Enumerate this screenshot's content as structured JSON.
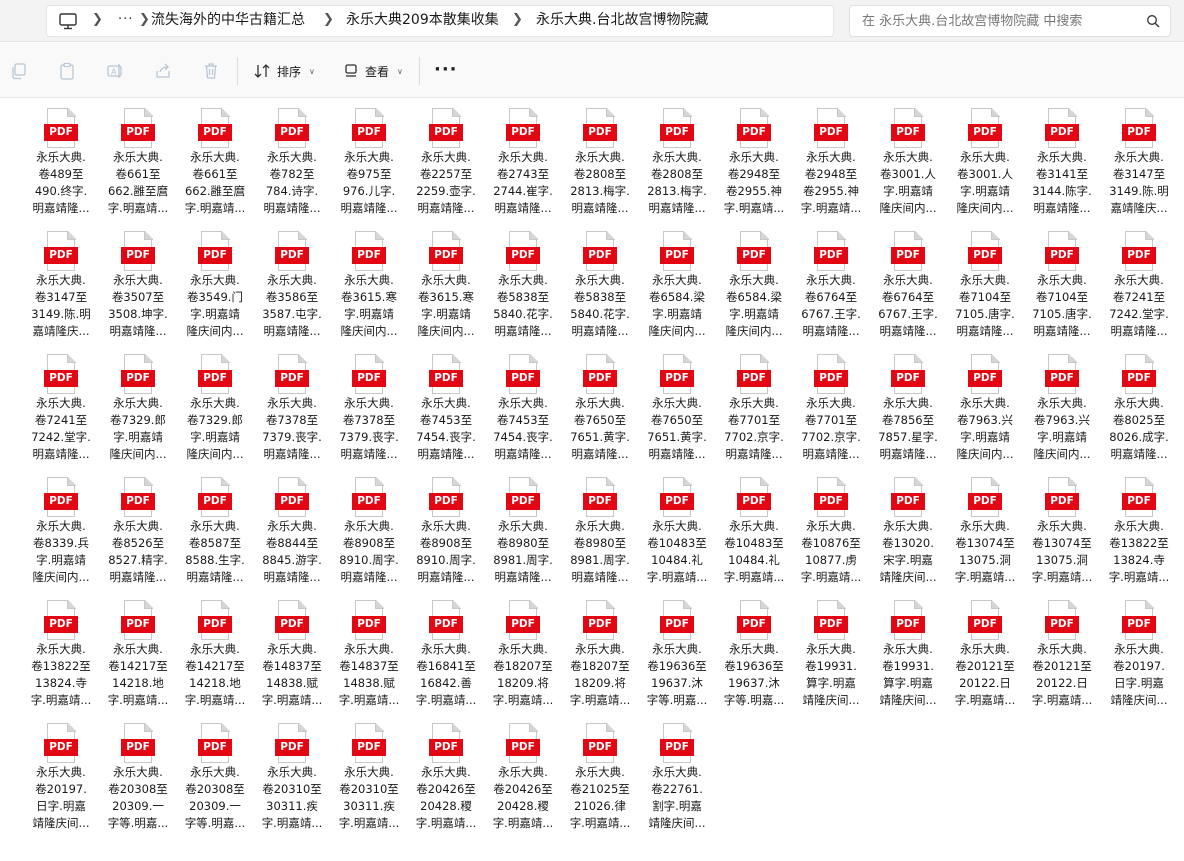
{
  "breadcrumb": {
    "more": "···",
    "items": [
      "流失海外的中华古籍汇总",
      "永乐大典209本散集收集",
      "永乐大典.台北故宫博物院藏"
    ]
  },
  "search": {
    "placeholder": "在 永乐大典.台北故宫博物院藏 中搜索"
  },
  "toolbar": {
    "sort_label": "排序",
    "view_label": "查看",
    "more_label": "···"
  },
  "files": [
    {
      "badge": "PDF",
      "name": "永乐大典.\n卷489至\n490.终字.\n明嘉靖隆..."
    },
    {
      "badge": "PDF",
      "name": "永乐大典.\n卷661至\n662.雝至麿\n字.明嘉靖..."
    },
    {
      "badge": "PDF",
      "name": "永乐大典.\n卷661至\n662.雝至麿\n字.明嘉靖..."
    },
    {
      "badge": "PDF",
      "name": "永乐大典.\n卷782至\n784.诗字.\n明嘉靖隆..."
    },
    {
      "badge": "PDF",
      "name": "永乐大典.\n卷975至\n976.儿字.\n明嘉靖隆..."
    },
    {
      "badge": "PDF",
      "name": "永乐大典.\n卷2257至\n2259.壶字.\n明嘉靖隆..."
    },
    {
      "badge": "PDF",
      "name": "永乐大典.\n卷2743至\n2744.崔字.\n明嘉靖隆..."
    },
    {
      "badge": "PDF",
      "name": "永乐大典.\n卷2808至\n2813.梅字.\n明嘉靖隆..."
    },
    {
      "badge": "PDF",
      "name": "永乐大典.\n卷2808至\n2813.梅字.\n明嘉靖隆..."
    },
    {
      "badge": "PDF",
      "name": "永乐大典.\n卷2948至\n卷2955.神\n字.明嘉靖..."
    },
    {
      "badge": "PDF",
      "name": "永乐大典.\n卷2948至\n卷2955.神\n字.明嘉靖..."
    },
    {
      "badge": "PDF",
      "name": "永乐大典.\n卷3001.人\n字.明嘉靖\n隆庆间内..."
    },
    {
      "badge": "PDF",
      "name": "永乐大典.\n卷3001.人\n字.明嘉靖\n隆庆间内..."
    },
    {
      "badge": "PDF",
      "name": "永乐大典.\n卷3141至\n3144.陈字.\n明嘉靖隆..."
    },
    {
      "badge": "PDF",
      "name": "永乐大典.\n卷3147至\n3149.陈.明\n嘉靖隆庆..."
    },
    {
      "badge": "PDF",
      "name": "永乐大典.\n卷3147至\n3149.陈.明\n嘉靖隆庆..."
    },
    {
      "badge": "PDF",
      "name": "永乐大典.\n卷3507至\n3508.坤字.\n明嘉靖隆..."
    },
    {
      "badge": "PDF",
      "name": "永乐大典.\n卷3549.门\n字.明嘉靖\n隆庆间内..."
    },
    {
      "badge": "PDF",
      "name": "永乐大典.\n卷3586至\n3587.屯字.\n明嘉靖隆..."
    },
    {
      "badge": "PDF",
      "name": "永乐大典.\n卷3615.寒\n字.明嘉靖\n隆庆间内..."
    },
    {
      "badge": "PDF",
      "name": "永乐大典.\n卷3615.寒\n字.明嘉靖\n隆庆间内..."
    },
    {
      "badge": "PDF",
      "name": "永乐大典.\n卷5838至\n5840.花字.\n明嘉靖隆..."
    },
    {
      "badge": "PDF",
      "name": "永乐大典.\n卷5838至\n5840.花字.\n明嘉靖隆..."
    },
    {
      "badge": "PDF",
      "name": "永乐大典.\n卷6584.梁\n字.明嘉靖\n隆庆间内..."
    },
    {
      "badge": "PDF",
      "name": "永乐大典.\n卷6584.梁\n字.明嘉靖\n隆庆间内..."
    },
    {
      "badge": "PDF",
      "name": "永乐大典.\n卷6764至\n6767.王字.\n明嘉靖隆..."
    },
    {
      "badge": "PDF",
      "name": "永乐大典.\n卷6764至\n6767.王字.\n明嘉靖隆..."
    },
    {
      "badge": "PDF",
      "name": "永乐大典.\n卷7104至\n7105.唐字.\n明嘉靖隆..."
    },
    {
      "badge": "PDF",
      "name": "永乐大典.\n卷7104至\n7105.唐字.\n明嘉靖隆..."
    },
    {
      "badge": "PDF",
      "name": "永乐大典.\n卷7241至\n7242.堂字.\n明嘉靖隆..."
    },
    {
      "badge": "PDF",
      "name": "永乐大典.\n卷7241至\n7242.堂字.\n明嘉靖隆..."
    },
    {
      "badge": "PDF",
      "name": "永乐大典.\n卷7329.郎\n字.明嘉靖\n隆庆间内..."
    },
    {
      "badge": "PDF",
      "name": "永乐大典.\n卷7329.郎\n字.明嘉靖\n隆庆间内..."
    },
    {
      "badge": "PDF",
      "name": "永乐大典.\n卷7378至\n7379.丧字.\n明嘉靖隆..."
    },
    {
      "badge": "PDF",
      "name": "永乐大典.\n卷7378至\n7379.丧字.\n明嘉靖隆..."
    },
    {
      "badge": "PDF",
      "name": "永乐大典.\n卷7453至\n7454.丧字.\n明嘉靖隆..."
    },
    {
      "badge": "PDF",
      "name": "永乐大典.\n卷7453至\n7454.丧字.\n明嘉靖隆..."
    },
    {
      "badge": "PDF",
      "name": "永乐大典.\n卷7650至\n7651.黄字.\n明嘉靖隆..."
    },
    {
      "badge": "PDF",
      "name": "永乐大典.\n卷7650至\n7651.黄字.\n明嘉靖隆..."
    },
    {
      "badge": "PDF",
      "name": "永乐大典.\n卷7701至\n7702.京字.\n明嘉靖隆..."
    },
    {
      "badge": "PDF",
      "name": "永乐大典.\n卷7701至\n7702.京字.\n明嘉靖隆..."
    },
    {
      "badge": "PDF",
      "name": "永乐大典.\n卷7856至\n7857.星字.\n明嘉靖隆..."
    },
    {
      "badge": "PDF",
      "name": "永乐大典.\n卷7963.兴\n字.明嘉靖\n隆庆间内..."
    },
    {
      "badge": "PDF",
      "name": "永乐大典.\n卷7963.兴\n字.明嘉靖\n隆庆间内..."
    },
    {
      "badge": "PDF",
      "name": "永乐大典.\n卷8025至\n8026.成字.\n明嘉靖隆..."
    },
    {
      "badge": "PDF",
      "name": "永乐大典.\n卷8339.兵\n字.明嘉靖\n隆庆间内..."
    },
    {
      "badge": "PDF",
      "name": "永乐大典.\n卷8526至\n8527.精字.\n明嘉靖隆..."
    },
    {
      "badge": "PDF",
      "name": "永乐大典.\n卷8587至\n8588.生字.\n明嘉靖隆..."
    },
    {
      "badge": "PDF",
      "name": "永乐大典.\n卷8844至\n8845.游字.\n明嘉靖隆..."
    },
    {
      "badge": "PDF",
      "name": "永乐大典.\n卷8908至\n8910.周字.\n明嘉靖隆..."
    },
    {
      "badge": "PDF",
      "name": "永乐大典.\n卷8908至\n8910.周字.\n明嘉靖隆..."
    },
    {
      "badge": "PDF",
      "name": "永乐大典.\n卷8980至\n8981.周字.\n明嘉靖隆..."
    },
    {
      "badge": "PDF",
      "name": "永乐大典.\n卷8980至\n8981.周字.\n明嘉靖隆..."
    },
    {
      "badge": "PDF",
      "name": "永乐大典.\n卷10483至\n10484.礼\n字.明嘉靖..."
    },
    {
      "badge": "PDF",
      "name": "永乐大典.\n卷10483至\n10484.礼\n字.明嘉靖..."
    },
    {
      "badge": "PDF",
      "name": "永乐大典.\n卷10876至\n10877.虏\n字.明嘉靖..."
    },
    {
      "badge": "PDF",
      "name": "永乐大典.\n卷13020.\n宋字.明嘉\n靖隆庆间..."
    },
    {
      "badge": "PDF",
      "name": "永乐大典.\n卷13074至\n13075.洞\n字.明嘉靖..."
    },
    {
      "badge": "PDF",
      "name": "永乐大典.\n卷13074至\n13075.洞\n字.明嘉靖..."
    },
    {
      "badge": "PDF",
      "name": "永乐大典.\n卷13822至\n13824.寺\n字.明嘉靖..."
    },
    {
      "badge": "PDF",
      "name": "永乐大典.\n卷13822至\n13824.寺\n字.明嘉靖..."
    },
    {
      "badge": "PDF",
      "name": "永乐大典.\n卷14217至\n14218.地\n字.明嘉靖..."
    },
    {
      "badge": "PDF",
      "name": "永乐大典.\n卷14217至\n14218.地\n字.明嘉靖..."
    },
    {
      "badge": "PDF",
      "name": "永乐大典.\n卷14837至\n14838.赋\n字.明嘉靖..."
    },
    {
      "badge": "PDF",
      "name": "永乐大典.\n卷14837至\n14838.赋\n字.明嘉靖..."
    },
    {
      "badge": "PDF",
      "name": "永乐大典.\n卷16841至\n16842.善\n字.明嘉靖..."
    },
    {
      "badge": "PDF",
      "name": "永乐大典.\n卷18207至\n18209.将\n字.明嘉靖..."
    },
    {
      "badge": "PDF",
      "name": "永乐大典.\n卷18207至\n18209.将\n字.明嘉靖..."
    },
    {
      "badge": "PDF",
      "name": "永乐大典.\n卷19636至\n19637.沐\n字等.明嘉..."
    },
    {
      "badge": "PDF",
      "name": "永乐大典.\n卷19636至\n19637.沐\n字等.明嘉..."
    },
    {
      "badge": "PDF",
      "name": "永乐大典.\n卷19931.\n算字.明嘉\n靖隆庆间..."
    },
    {
      "badge": "PDF",
      "name": "永乐大典.\n卷19931.\n算字.明嘉\n靖隆庆间..."
    },
    {
      "badge": "PDF",
      "name": "永乐大典.\n卷20121至\n20122.日\n字.明嘉靖..."
    },
    {
      "badge": "PDF",
      "name": "永乐大典.\n卷20121至\n20122.日\n字.明嘉靖..."
    },
    {
      "badge": "PDF",
      "name": "永乐大典.\n卷20197.\n日字.明嘉\n靖隆庆间..."
    },
    {
      "badge": "PDF",
      "name": "永乐大典.\n卷20197.\n日字.明嘉\n靖隆庆间..."
    },
    {
      "badge": "PDF",
      "name": "永乐大典.\n卷20308至\n20309.一\n字等.明嘉..."
    },
    {
      "badge": "PDF",
      "name": "永乐大典.\n卷20308至\n20309.一\n字等.明嘉..."
    },
    {
      "badge": "PDF",
      "name": "永乐大典.\n卷20310至\n30311.疾\n字.明嘉靖..."
    },
    {
      "badge": "PDF",
      "name": "永乐大典.\n卷20310至\n30311.疾\n字.明嘉靖..."
    },
    {
      "badge": "PDF",
      "name": "永乐大典.\n卷20426至\n20428.稷\n字.明嘉靖..."
    },
    {
      "badge": "PDF",
      "name": "永乐大典.\n卷20426至\n20428.稷\n字.明嘉靖..."
    },
    {
      "badge": "PDF",
      "name": "永乐大典.\n卷21025至\n21026.律\n字.明嘉靖..."
    },
    {
      "badge": "PDF",
      "name": "永乐大典.\n卷22761.\n割字.明嘉\n靖隆庆间..."
    }
  ],
  "colors": {
    "pdf_badge": "#e30613",
    "topbar_bg": "#f3f3f3",
    "cmdbar_bg": "#f9f9f9"
  },
  "icons": [
    "monitor-icon",
    "chevron-right-icon",
    "search-icon",
    "copy-icon",
    "paste-icon",
    "rename-icon",
    "share-icon",
    "delete-icon",
    "sort-icon",
    "view-icon",
    "pdf-file-icon"
  ]
}
